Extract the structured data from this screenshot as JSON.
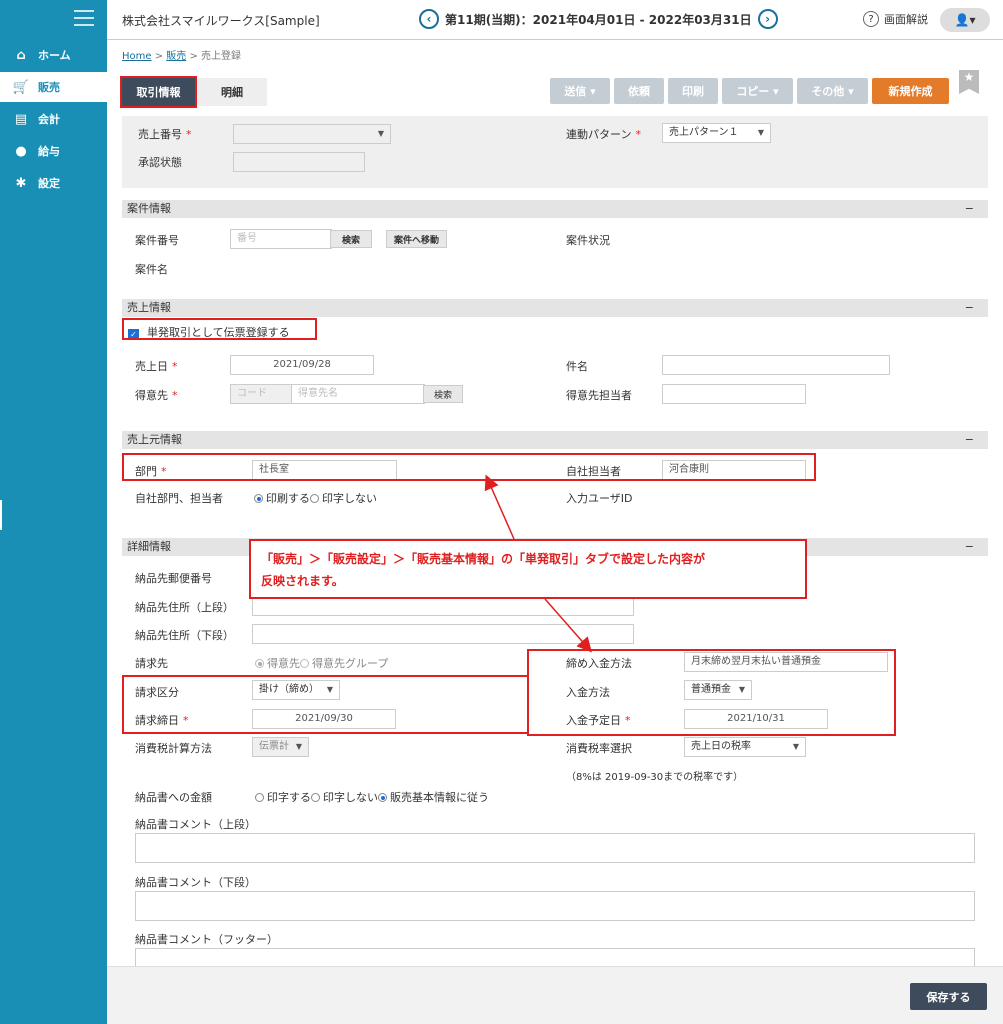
{
  "sidebar": {
    "items": [
      {
        "label": "ホーム",
        "icon": "home-icon",
        "glyph": "⌂"
      },
      {
        "label": "販売",
        "icon": "cart-icon",
        "glyph": "🛒"
      },
      {
        "label": "会計",
        "icon": "calculator-icon",
        "glyph": "▤"
      },
      {
        "label": "給与",
        "icon": "money-bag-icon",
        "glyph": "●"
      },
      {
        "label": "設定",
        "icon": "gear-icon",
        "glyph": "✱"
      }
    ]
  },
  "header": {
    "company": "株式会社スマイルワークス[Sample]",
    "period": "第11期(当期)：2021年04月01日 - 2022年03月31日",
    "prev": "‹",
    "next": "›",
    "help_icon": "?",
    "help": "画面解説",
    "user_glyph": "👤▾"
  },
  "breadcrumb": {
    "home": "Home",
    "sep": " > ",
    "sales": "販売",
    "current": "売上登録"
  },
  "tabs": {
    "torihiki": "取引情報",
    "meisai": "明細"
  },
  "toolbar": {
    "send": "送信 ▾",
    "request": "依頼",
    "print": "印刷",
    "copy": "コピー ▾",
    "other": "その他 ▾",
    "new": "新規作成",
    "star": "★"
  },
  "top": {
    "sales_no_label": "売上番号",
    "approval_label": "承認状態",
    "link_pattern_label": "連動パターン",
    "link_pattern_value": "売上パターン１"
  },
  "req_mark": "*",
  "minus": "−",
  "arrow_glyph": "▼",
  "case": {
    "title": "案件情報",
    "no_label": "案件番号",
    "no_placeholder": "番号",
    "search": "検索",
    "move": "案件へ移動",
    "status_label": "案件状況",
    "name_label": "案件名"
  },
  "sales": {
    "title": "売上情報",
    "single_check": "単発取引として伝票登録する",
    "date_label": "売上日",
    "date_value": "2021/09/28",
    "customer_label": "得意先",
    "code_placeholder": "コード",
    "customer_placeholder": "得意先名",
    "search": "検索",
    "subject_label": "件名",
    "customer_rep_label": "得意先担当者"
  },
  "source": {
    "title": "売上元情報",
    "dept_label": "部門",
    "dept_value": "社長室",
    "rep_label": "自社担当者",
    "rep_value": "河合康則",
    "print_label": "自社部門、担当者",
    "print_on": "印刷する",
    "print_off": "印字しない",
    "input_user_label": "入力ユーザID"
  },
  "detail": {
    "title": "詳細情報",
    "zip_label": "納品先郵便番号",
    "addr1_label": "納品先住所（上段）",
    "addr2_label": "納品先住所（下段）",
    "billto_label": "請求先",
    "billto_opt1": "得意先",
    "billto_opt2": "得意先グループ",
    "closing_method_label": "締め入金方法",
    "closing_method_value": "月末締め翌月末払い普通預金",
    "billing_type_label": "請求区分",
    "billing_type_value": "掛け（締め）",
    "payment_method_label": "入金方法",
    "payment_method_value": "普通預金",
    "billing_date_label": "請求締日",
    "billing_date_value": "2021/09/30",
    "payment_date_label": "入金予定日",
    "payment_date_value": "2021/10/31",
    "tax_calc_label": "消費税計算方法",
    "tax_calc_value": "伝票計",
    "tax_rate_label": "消費税率選択",
    "tax_rate_value": "売上日の税率",
    "tax_note": "（8%は 2019-09-30までの税率です）",
    "amount_label": "納品書への金額",
    "amount_opt1": "印字する",
    "amount_opt2": "印字しない",
    "amount_opt3": "販売基本情報に従う",
    "comment_top_label": "納品書コメント（上段）",
    "comment_bottom_label": "納品書コメント（下段）",
    "comment_footer_label": "納品書コメント（フッター）"
  },
  "callout": {
    "line1": "「販売」＞「販売設定」＞「販売基本情報」の「単発取引」タブで設定した内容が",
    "line2": "反映されます。"
  },
  "footer": {
    "save": "保存する"
  },
  "colors": {
    "sidebar": "#1a8fb5",
    "accent_orange": "#e47b2a",
    "highlight_red": "#e02020",
    "dark_button": "#3d4b5c"
  }
}
